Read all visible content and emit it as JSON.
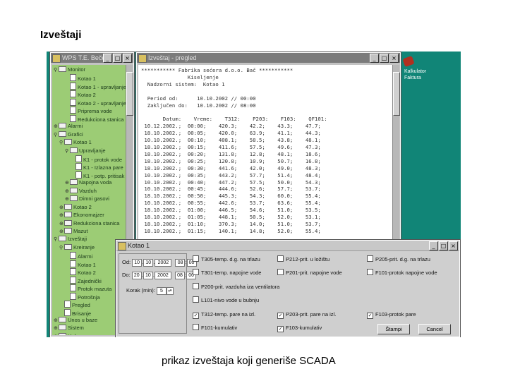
{
  "slide": {
    "title": "Izveštaji",
    "caption": "prikaz izveštaja koji generiše SCADA"
  },
  "tree_window": {
    "title": "WPS T.E. Bečej",
    "items": [
      {
        "label": "Monitor",
        "tog": "⚲"
      },
      {
        "label": "Kotao 1",
        "tog": ""
      },
      {
        "label": "Kotao 1 - upravljanje",
        "tog": ""
      },
      {
        "label": "Kotao 2",
        "tog": ""
      },
      {
        "label": "Kotao 2 - upravljanje",
        "tog": ""
      },
      {
        "label": "Priprema vode",
        "tog": ""
      },
      {
        "label": "Redukciona stanica",
        "tog": ""
      },
      {
        "label": "Alarmi",
        "tog": "⊕"
      },
      {
        "label": "Grafici",
        "tog": "⚲"
      },
      {
        "label": "Kotao 1",
        "tog": "⚲"
      },
      {
        "label": "Upravljanje",
        "tog": "⚲"
      },
      {
        "label": "K1 - protok vode",
        "tog": ""
      },
      {
        "label": "K1 - Izlazna pare",
        "tog": ""
      },
      {
        "label": "K1 - potp. pritisak",
        "tog": ""
      },
      {
        "label": "Napojna voda",
        "tog": "⊕"
      },
      {
        "label": "Vazduh",
        "tog": "⊕"
      },
      {
        "label": "Dimni gasovi",
        "tog": "⊕"
      },
      {
        "label": "Kotao 2",
        "tog": "⊕"
      },
      {
        "label": "Ekonomajzer",
        "tog": "⊕"
      },
      {
        "label": "Redukciona stanica",
        "tog": "⊕"
      },
      {
        "label": "Mazut",
        "tog": "⊕"
      },
      {
        "label": "Izveštaji",
        "tog": "⚲"
      },
      {
        "label": "Kreiranje",
        "tog": "⚲"
      },
      {
        "label": "Alarmi",
        "tog": ""
      },
      {
        "label": "Kotao 1",
        "tog": ""
      },
      {
        "label": "Kotao 2",
        "tog": ""
      },
      {
        "label": "Zajednički",
        "tog": ""
      },
      {
        "label": "Protok mazuta",
        "tog": ""
      },
      {
        "label": "Potrošnja",
        "tog": ""
      },
      {
        "label": "Pregled",
        "tog": ""
      },
      {
        "label": "Brisanje",
        "tog": ""
      },
      {
        "label": "Unos u baze",
        "tog": "⊕"
      },
      {
        "label": "Sistem",
        "tog": "⊕"
      },
      {
        "label": "Help",
        "tog": "⊕"
      }
    ]
  },
  "report_window": {
    "title": "Izveštaj - pregled",
    "text": "*********** Fabrika sećera d.o.o. Bač ***********\n               Kiseljenje\n  Nadzorni sistem:  Kotao 1\n\n  Period od:      10.10.2002 // 00:00\n  Zaključen do:   10.10.2002 // 08:00\n\n       Datum:    Vreme:    T312:    P203:    F103:    QF101:\n 10.12.2002.;  00:00;    420.3;    42.2;    43.3;    47.7;\n 18.10.2002.;  00:05;    420.0;    63.9;    41.1;    44.3;\n 10.10.2002.;  00:10;    408.1;    58.5;    43.8;    48.1;\n 18.10.2002.;  00:15;    411.6;    57.5;    49.6;    47.3;\n 18.10.2002.;  00:20;    131.8;    12.8;    48.1;    18.6;\n 18.10.2002.;  00:25;    120.8;    10.9;    50.7;    16.8;\n 18.10.2002.;  00:30;    441.6;    42.0;    49.0;    48.3;\n 10.10.2002.;  00:35;    443.2;    57.7;    51.4;    48.4;\n 10.10.2002.;  00:40;    447.2;    57.5;    50.0;    54.3;\n 10.10.2002.;  00:45;    444.6;    52.6;    57.7;    53.7;\n 18.10.2002.;  00:50;    445.3;    54.3;    60.0;    55.4;\n 10.10.2002.;  00:55;    442.6;    53.7;    63.6;    55.4;\n 18.10.2002.;  01:00;    446.5;    54.6;    51.0;    53.5;\n 18.10.2002.;  01:05;    448.1;    50.5;    52.0;    53.1;\n 18.10.2002.;  01:10;    370.3;    14.0;    51.0;    53.7;\n 18.10.2002.;  01:15;    140.1;    14.8;    52.0;    55.4;"
  },
  "desktop_icon": {
    "label": "Kalkulator\nFaktura"
  },
  "kotao_dialog": {
    "title": "Kotao 1",
    "od_label": "Od:",
    "od_date": [
      "10",
      "10",
      "2002"
    ],
    "od_time": [
      "08",
      "00"
    ],
    "do_label": "Do:",
    "do_date": [
      "20",
      "10",
      "2002"
    ],
    "do_time": [
      "08",
      "00"
    ],
    "korak_label": "Korak (min):",
    "korak_value": "5",
    "checks": [
      {
        "label": "T305-temp. d.g. na trlazu",
        "checked": false
      },
      {
        "label": "T301-temp. napojne vode",
        "checked": false
      },
      {
        "label": "P200-prit. vazduha iza ventilatora",
        "checked": false
      },
      {
        "label": "L101-nivo vode u bubnju",
        "checked": false
      },
      {
        "label": "T312-temp. pare na izl.",
        "checked": true
      },
      {
        "label": "F101-kumulativ",
        "checked": false
      },
      {
        "label": "P212-prit. u ložištu",
        "checked": false
      },
      {
        "label": "P201-prit. napojne vode",
        "checked": false
      },
      {
        "label": "P203-prit. pare na izl.",
        "checked": true
      },
      {
        "label": "F103-kumulativ",
        "checked": true
      },
      {
        "label": "P205-prit. d.g. na trlazu",
        "checked": false
      },
      {
        "label": "F101-protok napojne vode",
        "checked": false
      },
      {
        "label": "F103-protok pare",
        "checked": true
      }
    ],
    "ok_label": "Štampi",
    "cancel_label": "Cancel"
  },
  "colors": {
    "desktop": "#118577",
    "tree_bg": "#9ccc75",
    "window_gray": "#c3c3c3"
  }
}
